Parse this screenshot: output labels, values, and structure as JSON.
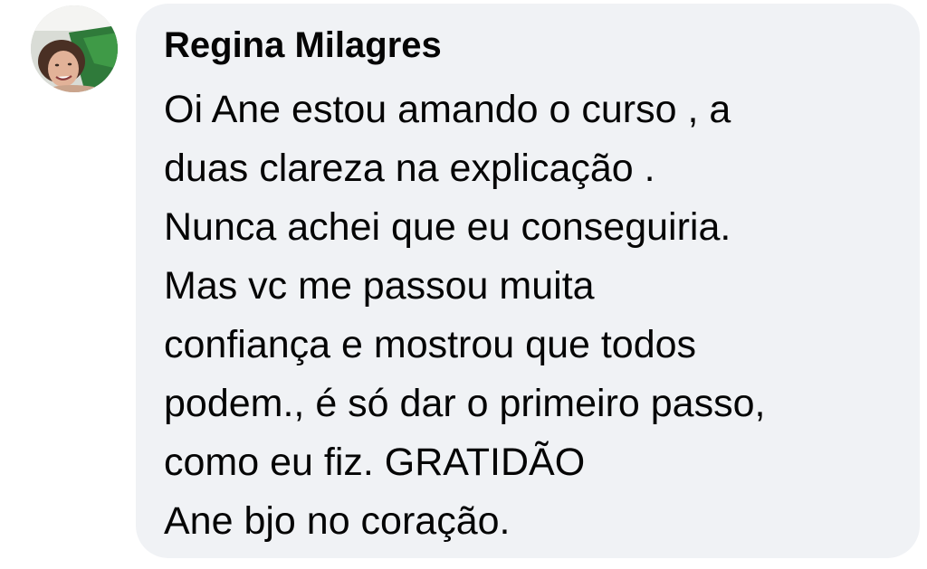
{
  "comment": {
    "author": "Regina Milagres",
    "avatar_icon": "user-photo-avatar",
    "lines": [
      "Oi Ane estou amando o curso , a",
      "duas clareza na explicação .",
      "Nunca achei que eu conseguiria.",
      "Mas vc me passou muita",
      "confiança e mostrou que todos",
      "podem., é só dar o primeiro passo,",
      "como eu fiz. GRATIDÃO",
      "Ane bjo no coração."
    ]
  },
  "colors": {
    "bubble_background": "#f0f2f5",
    "text": "#050505"
  }
}
